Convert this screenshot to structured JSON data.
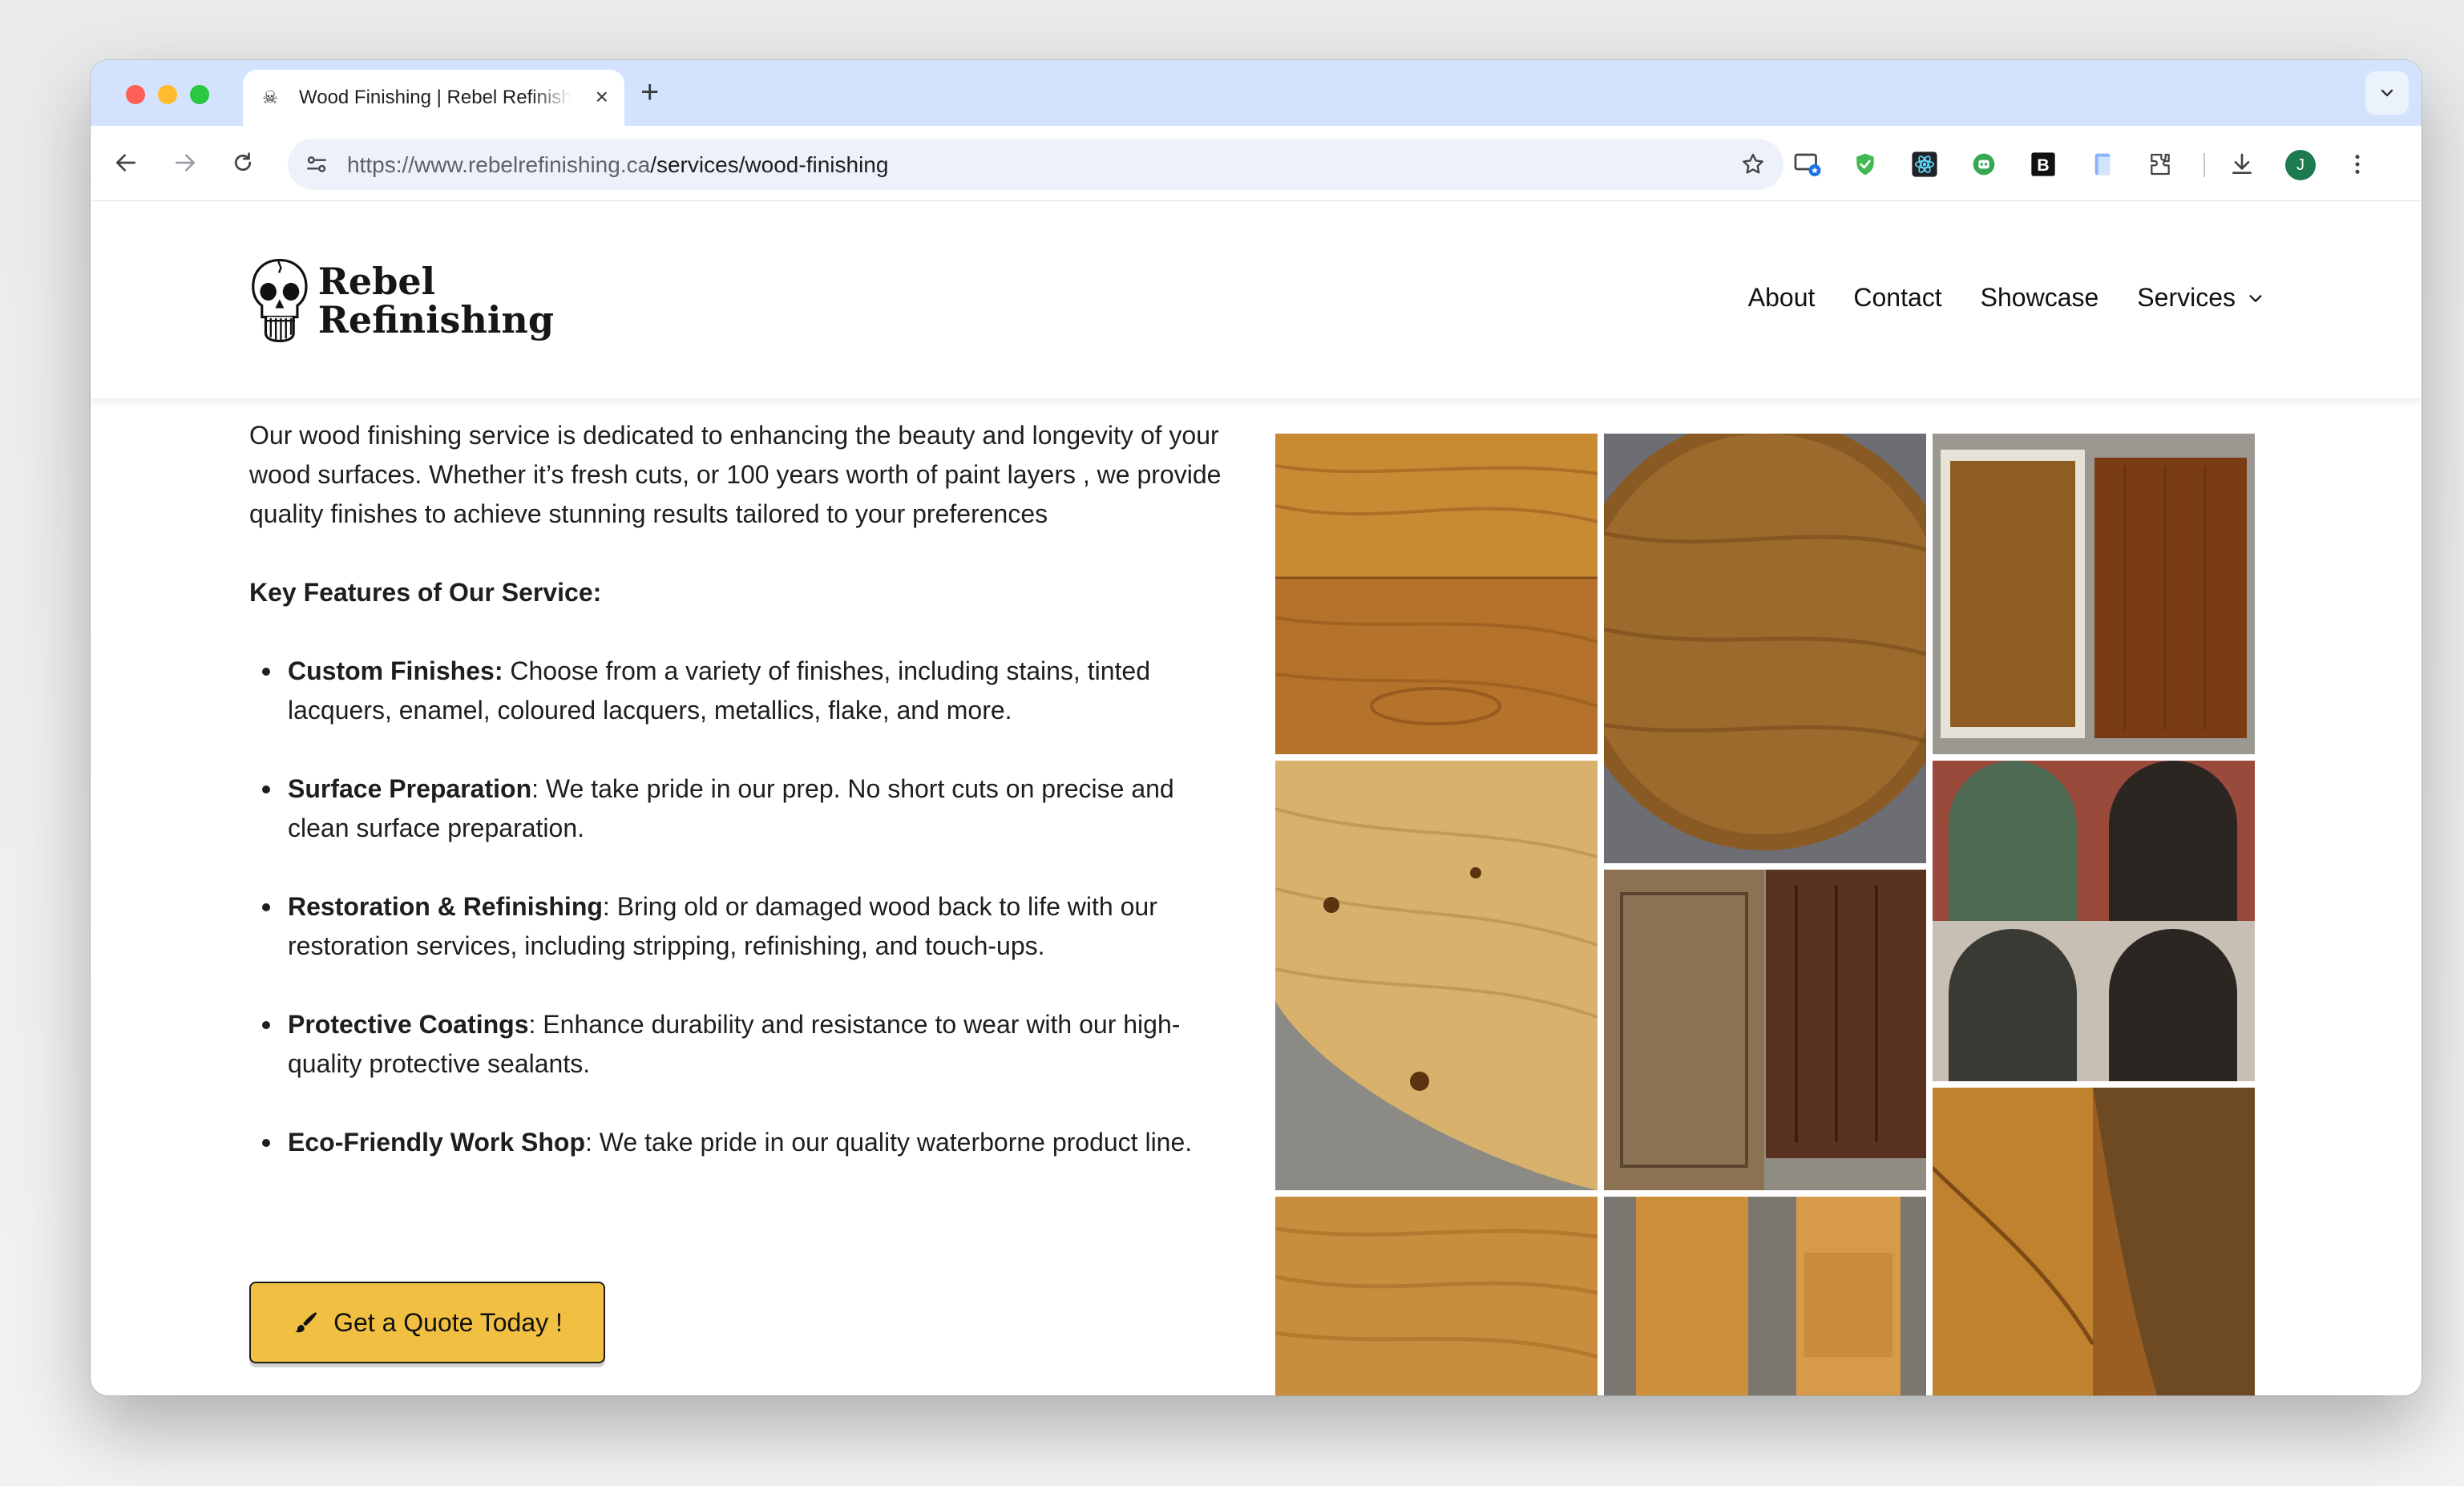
{
  "browser": {
    "tab_title": "Wood Finishing | Rebel Refinishing",
    "url_host": "https://www.rebelrefinishing.ca",
    "url_path": "/services/wood-finishing",
    "profile_initial": "J"
  },
  "site": {
    "logo_line1": "Rebel",
    "logo_line2": "Refinishing",
    "nav": {
      "about": "About",
      "contact": "Contact",
      "showcase": "Showcase",
      "services": "Services"
    }
  },
  "content": {
    "intro": "Our wood finishing service is dedicated to enhancing the beauty and longevity of your wood surfaces. Whether it’s fresh cuts, or 100 years worth of paint layers , we provide quality finishes to achieve stunning results tailored to your preferences",
    "features_heading": "Key Features of Our Service:",
    "features": [
      {
        "title": "Custom Finishes:",
        "text": " Choose from a variety of finishes, including stains, tinted lacquers, enamel, coloured lacquers, metallics, flake, and more."
      },
      {
        "title": "Surface Preparation",
        "text": ": We take pride in our prep. No short cuts on precise and clean surface preparation."
      },
      {
        "title": "Restoration & Refinishing",
        "text": ": Bring old or damaged wood back to life with our restoration services, including stripping, refinishing, and touch-ups."
      },
      {
        "title": "Protective Coatings",
        "text": ": Enhance durability and resistance to wear with our high-quality protective sealants."
      },
      {
        "title": "Eco-Friendly Work Shop",
        "text": ": We take pride in our quality waterborne product line."
      }
    ],
    "cta_label": "Get a Quote Today !"
  },
  "colors": {
    "accent": "#f1c043",
    "tabstrip": "#d3e3fd"
  },
  "icons": {
    "cta": "paintbrush-icon",
    "services": "chevron-down-icon"
  }
}
